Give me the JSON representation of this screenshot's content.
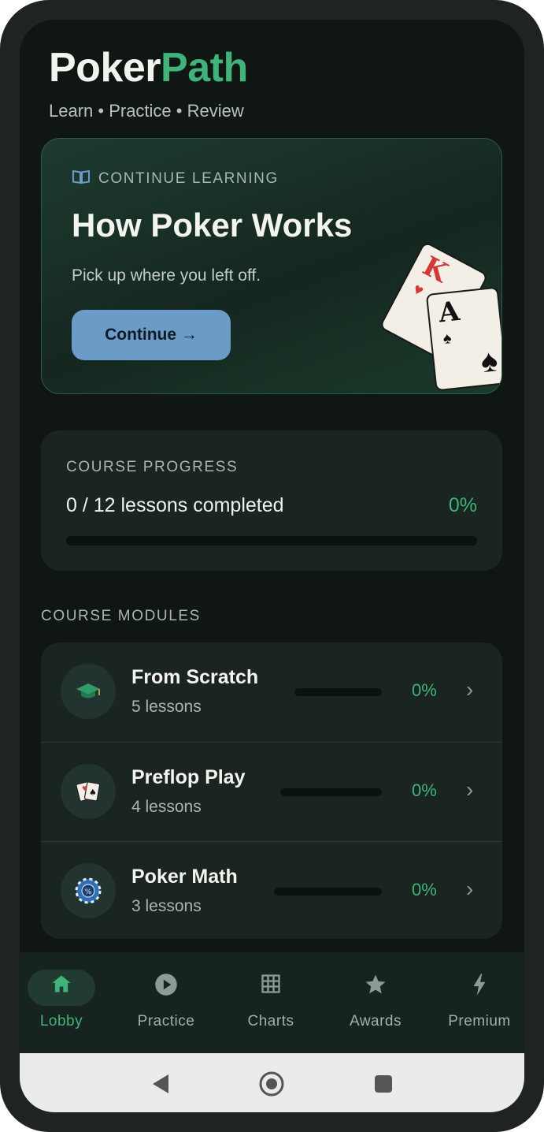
{
  "header": {
    "brand_part1": "Poker",
    "brand_part2": "Path",
    "tagline": "Learn • Practice • Review"
  },
  "continue_card": {
    "kicker": "CONTINUE LEARNING",
    "kicker_icon": "book-icon",
    "title": "How Poker Works",
    "subtitle": "Pick up where you left off.",
    "button_label": "Continue →",
    "card_ranks": [
      "K",
      "A"
    ],
    "card_suits": [
      "♥",
      "♠"
    ]
  },
  "progress": {
    "label": "COURSE PROGRESS",
    "count_text": "0 / 12 lessons completed",
    "percent_text": "0%",
    "percent_value": 0
  },
  "modules": {
    "title": "COURSE MODULES",
    "items": [
      {
        "name": "From Scratch",
        "lessons": "5 lessons",
        "percent": "0%",
        "progress": 0,
        "icon": "graduation-cap-icon"
      },
      {
        "name": "Preflop Play",
        "lessons": "4 lessons",
        "percent": "0%",
        "progress": 0,
        "icon": "playing-cards-icon"
      },
      {
        "name": "Poker Math",
        "lessons": "3 lessons",
        "percent": "0%",
        "progress": 0,
        "icon": "poker-chip-icon"
      }
    ]
  },
  "bottom_nav": {
    "active": "Lobby",
    "items": [
      {
        "label": "Lobby",
        "icon": "home-icon"
      },
      {
        "label": "Practice",
        "icon": "play-icon"
      },
      {
        "label": "Charts",
        "icon": "grid-icon"
      },
      {
        "label": "Awards",
        "icon": "star-icon"
      },
      {
        "label": "Premium",
        "icon": "lightning-icon"
      }
    ]
  },
  "colors": {
    "accent_green": "#3fb37a",
    "button_blue": "#6a9cc7",
    "background": "#0f1614",
    "card_surface": "#1a2522"
  }
}
